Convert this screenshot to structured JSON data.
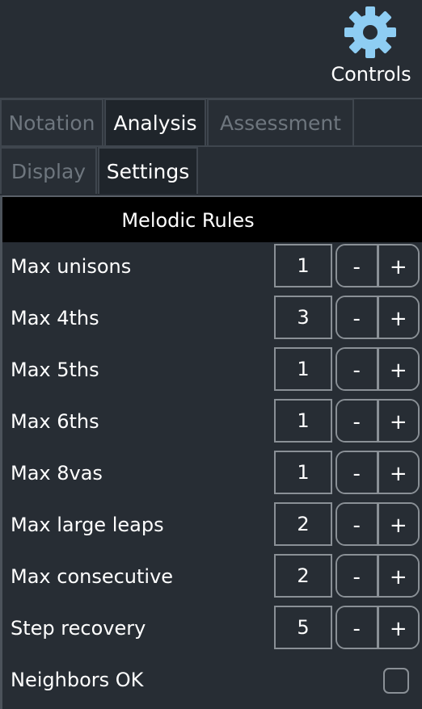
{
  "header": {
    "icon": "gear-icon",
    "controls_label": "Controls",
    "icon_color": "#8ecdf3"
  },
  "tabs_primary": [
    {
      "label": "Notation",
      "active": false
    },
    {
      "label": "Analysis",
      "active": true
    },
    {
      "label": "Assessment",
      "active": false
    }
  ],
  "tabs_secondary": [
    {
      "label": "Display",
      "active": false
    },
    {
      "label": "Settings",
      "active": true
    }
  ],
  "section": {
    "title": "Melodic Rules"
  },
  "rules": [
    {
      "label": "Max unisons",
      "value": "1",
      "minus": "-",
      "plus": "+"
    },
    {
      "label": "Max 4ths",
      "value": "3",
      "minus": "-",
      "plus": "+"
    },
    {
      "label": "Max 5ths",
      "value": "1",
      "minus": "-",
      "plus": "+"
    },
    {
      "label": "Max 6ths",
      "value": "1",
      "minus": "-",
      "plus": "+"
    },
    {
      "label": "Max 8vas",
      "value": "1",
      "minus": "-",
      "plus": "+"
    },
    {
      "label": "Max large leaps",
      "value": "2",
      "minus": "-",
      "plus": "+"
    },
    {
      "label": "Max consecutive",
      "value": "2",
      "minus": "-",
      "plus": "+"
    },
    {
      "label": "Step recovery",
      "value": "5",
      "minus": "-",
      "plus": "+"
    }
  ],
  "neighbors": {
    "label": "Neighbors OK",
    "checked": false
  }
}
